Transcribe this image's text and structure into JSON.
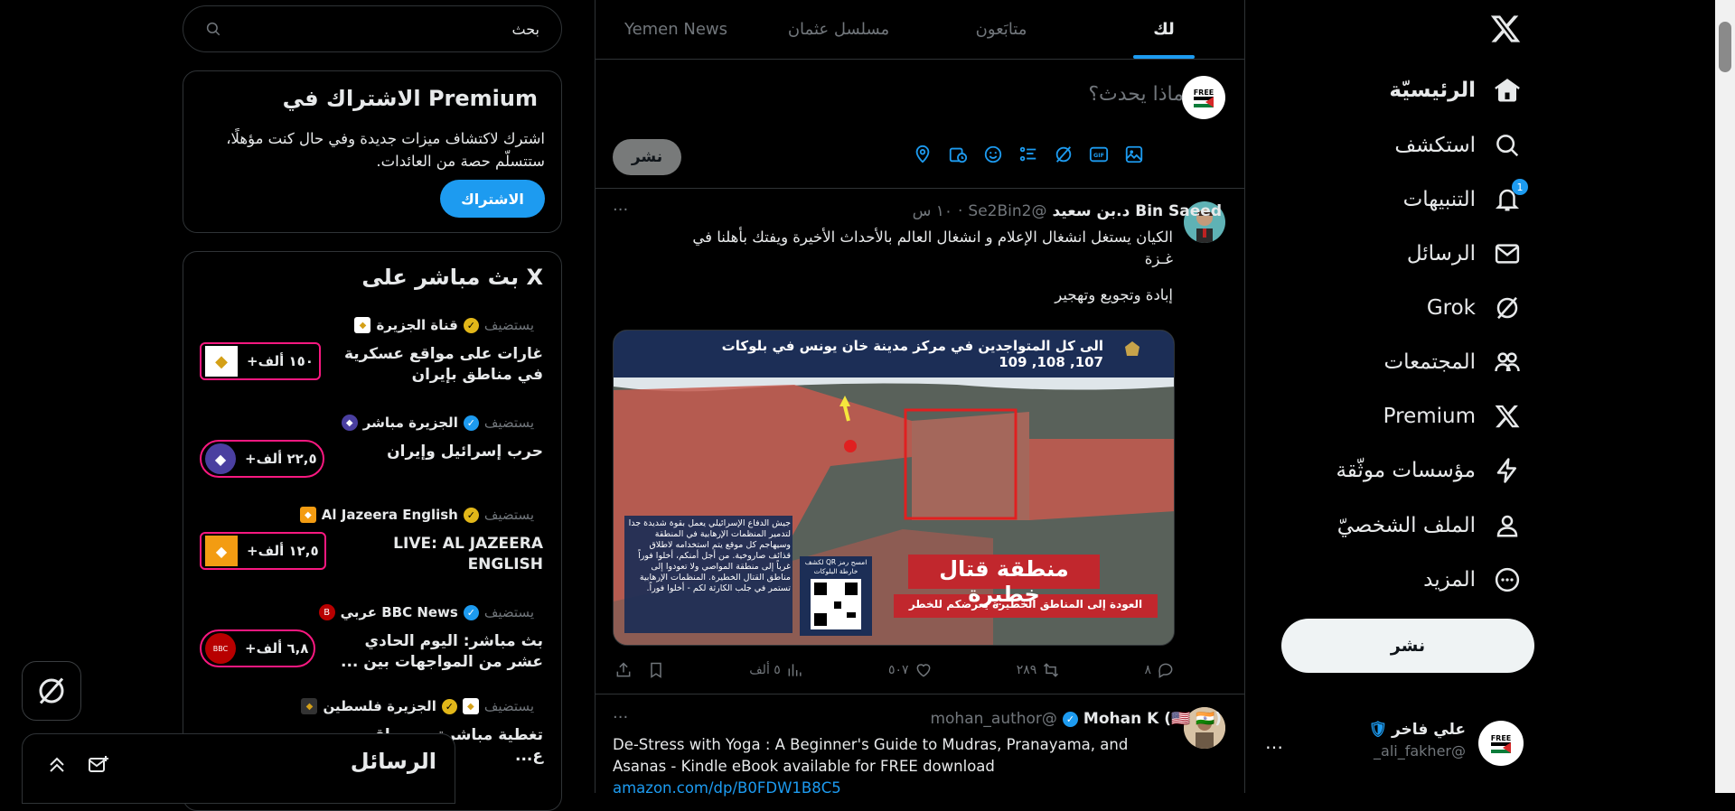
{
  "nav": {
    "items": [
      {
        "label": "الرئيسيّة",
        "icon": "home-icon",
        "active": true
      },
      {
        "label": "استكشف",
        "icon": "search-icon"
      },
      {
        "label": "التنبيهات",
        "icon": "bell-icon",
        "badge": "1"
      },
      {
        "label": "الرسائل",
        "icon": "mail-icon"
      },
      {
        "label": "Grok",
        "icon": "grok-icon"
      },
      {
        "label": "المجتمعات",
        "icon": "communities-icon"
      },
      {
        "label": "Premium",
        "icon": "x-logo-icon"
      },
      {
        "label": "مؤسسات موثّقة",
        "icon": "lightning-icon"
      },
      {
        "label": "الملف الشخصيّ",
        "icon": "person-icon"
      },
      {
        "label": "المزيد",
        "icon": "more-circle-icon"
      }
    ],
    "post_label": "نشر",
    "account": {
      "name": "علي فاخر",
      "handle": "@ali_fakher_",
      "more": "…"
    }
  },
  "tabs": [
    {
      "label": "لك",
      "active": true
    },
    {
      "label": "متابَعون"
    },
    {
      "label": "مسلسل عثمان"
    },
    {
      "label": "Yemen News"
    }
  ],
  "compose": {
    "placeholder": "ماذا يحدث؟",
    "post_label": "نشر",
    "avatar_text": "FREE PALESTINE"
  },
  "tweets": [
    {
      "name": "Bin Saeed د.بن سعيد",
      "handle": "@Se2Bin2",
      "time": "١٠ س",
      "text_line1": "الكيان يستغل انشغال الإعلام و انشغال العالم بالأحداث الأخيرة ويفتك بأهلنا في",
      "text_line2": "غـزة",
      "text_line3": "إبادة وتجويع وتهجير",
      "media": {
        "header": "الى كل المتواجدين في مركز مدينة خان يونس في بلوكات",
        "header_nums": "107, 108, 109",
        "left_text": "جيش الدفاع الإسرائيلي يعمل بقوة شديدة جدا لتدمير المنظمات الإرهابية في المنطقة وسيهاجم كل موقع يتم استخدامه لاطلاق قذائف صاروخية. من أجل أمنكم، أخلوا فوراً غرباً إلى منطقة المواصي ولا تعودوا إلى مناطق القتال الخطيرة. المنظمات الإرهابية تستمر في جلب الكارثة لكم - أخلوا فوراً.",
        "qr_text": "امسح رمز QR لكشف خارطة البلوكات",
        "banner": "منطقة قتال خطيرة",
        "banner_sub": "العودة إلى المناطق الخطيرة يعرضكم للخطر"
      },
      "replies": "٨",
      "retweets": "٢٨٩",
      "likes": "٥٠٧",
      "views": "٥ ألف"
    },
    {
      "name": "Mohan K (🇺🇸 🇮🇳)",
      "handle": "@mohan_author",
      "text": "De-Stress with Yoga : A Beginner's Guide to Mudras, Pranayama, and Asanas - Kindle eBook available for FREE download",
      "link": "amazon.com/dp/B0FDW1B8C5"
    }
  ],
  "search": {
    "placeholder": "بحث"
  },
  "premium": {
    "title": "Premium الاشتراك في",
    "body": "اشترك لاكتشاف ميزات جديدة وفي حال كنت مؤهلًا، ستتسلّم حصة من العائدات.",
    "button": "الاشتراك"
  },
  "live": {
    "title": "X بث مباشر على",
    "host_label": "يستضيف",
    "items": [
      {
        "host": "قناة الجزيرة",
        "title": "غارات على مواقع عسكرية في مناطق بإيران",
        "count": "+١٥٠ ألف"
      },
      {
        "host": "الجزيرة مباشر",
        "title": "حرب إسرائيل وإيران",
        "count": "+٢٢,٥ ألف"
      },
      {
        "host": "Al Jazeera English",
        "title": "LIVE: AL JAZEERA ENGLISH",
        "count": "+١٢,٥ ألف"
      },
      {
        "host": "BBC News عربي",
        "title": "بث مباشر: اليوم الحادي عشر من المواجهات بين ...",
        "count": "+٦,٨ ألف"
      },
      {
        "host": "الجزيرة فلسطين",
        "title": "تغطية مباشرة ... مواقع ع...",
        "count": ""
      }
    ]
  },
  "messages_drawer": {
    "title": "الرسائل"
  },
  "colors": {
    "accent": "#1d9bf0",
    "live": "#f91880",
    "bg": "#000000"
  }
}
